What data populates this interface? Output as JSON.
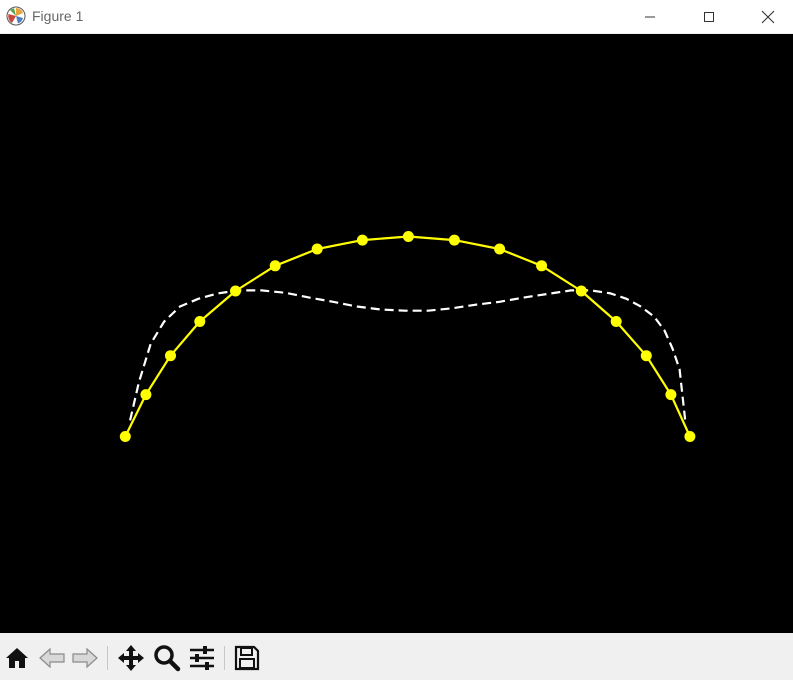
{
  "window": {
    "title": "Figure 1"
  },
  "icons": {
    "app": "matplotlib-icon",
    "minimize": "minimize-icon",
    "maximize": "maximize-icon",
    "close": "close-icon"
  },
  "toolbar": {
    "items": [
      {
        "name": "home-button",
        "icon": "home-icon"
      },
      {
        "name": "back-button",
        "icon": "back-arrow-icon"
      },
      {
        "name": "forward-button",
        "icon": "forward-arrow-icon"
      },
      {
        "name": "pan-button",
        "icon": "move-icon"
      },
      {
        "name": "zoom-button",
        "icon": "magnifier-icon"
      },
      {
        "name": "configure-subplots-button",
        "icon": "sliders-icon"
      },
      {
        "name": "save-button",
        "icon": "floppy-disk-icon"
      }
    ]
  },
  "chart_data": {
    "type": "line",
    "background": "#000000",
    "axes_visible": false,
    "grid": false,
    "xlim": [
      0,
      1
    ],
    "ylim": [
      0,
      1
    ],
    "series": [
      {
        "style": "solid",
        "marker": "circle",
        "color": "#ffff00",
        "x": [
          0.158,
          0.184,
          0.215,
          0.252,
          0.297,
          0.347,
          0.4,
          0.457,
          0.515,
          0.573,
          0.63,
          0.683,
          0.733,
          0.777,
          0.815,
          0.846,
          0.87
        ],
        "y": [
          0.328,
          0.398,
          0.463,
          0.52,
          0.571,
          0.613,
          0.641,
          0.656,
          0.662,
          0.656,
          0.641,
          0.613,
          0.571,
          0.52,
          0.463,
          0.398,
          0.328
        ]
      },
      {
        "style": "dashed",
        "marker": "none",
        "color": "#ffffff",
        "x": [
          0.164,
          0.175,
          0.19,
          0.207,
          0.227,
          0.25,
          0.275,
          0.3,
          0.33,
          0.36,
          0.39,
          0.42,
          0.45,
          0.48,
          0.51,
          0.54,
          0.57,
          0.6,
          0.63,
          0.66,
          0.69,
          0.72,
          0.745,
          0.77,
          0.79,
          0.808,
          0.825,
          0.838,
          0.848,
          0.857,
          0.864
        ],
        "y": [
          0.355,
          0.418,
          0.483,
          0.52,
          0.545,
          0.558,
          0.567,
          0.572,
          0.572,
          0.568,
          0.56,
          0.553,
          0.545,
          0.54,
          0.538,
          0.538,
          0.542,
          0.548,
          0.553,
          0.56,
          0.566,
          0.572,
          0.572,
          0.567,
          0.558,
          0.545,
          0.528,
          0.505,
          0.475,
          0.44,
          0.355
        ]
      }
    ]
  }
}
